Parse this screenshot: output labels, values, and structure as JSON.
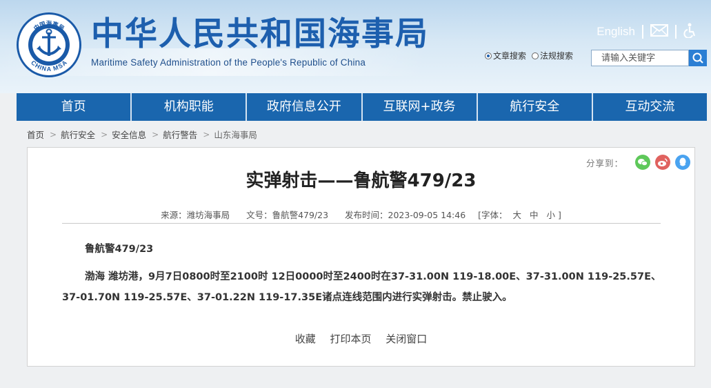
{
  "header": {
    "emblem_text_top": "中国海事局",
    "emblem_text_bottom": "CHINA MSA",
    "site_title": "中华人民共和国海事局",
    "site_subtitle": "Maritime Safety Administration of the People's Republic of China",
    "lang_link": "English",
    "mail_icon": "mail-icon",
    "accessibility_icon": "accessibility-icon"
  },
  "search": {
    "options": [
      {
        "label": "文章搜索",
        "selected": true
      },
      {
        "label": "法规搜索",
        "selected": false
      }
    ],
    "placeholder": "请输入关键字",
    "button_icon": "search-icon"
  },
  "nav": {
    "items": [
      "首页",
      "机构职能",
      "政府信息公开",
      "互联网+政务",
      "航行安全",
      "互动交流"
    ]
  },
  "breadcrumb": [
    "首页",
    "航行安全",
    "安全信息",
    "航行警告",
    "山东海事局"
  ],
  "share": {
    "label": "分享到：",
    "targets": [
      {
        "name": "wechat",
        "icon": "wechat-icon",
        "color": "#5ec85a"
      },
      {
        "name": "weibo",
        "icon": "weibo-icon",
        "color": "#e0625f"
      },
      {
        "name": "qq",
        "icon": "qq-icon",
        "color": "#4aa3f0"
      }
    ]
  },
  "article": {
    "title": "实弹射击——鲁航警479/23",
    "meta": {
      "source": "来源：潍坊海事局",
      "doc_no": "文号：鲁航警479/23",
      "published": "发布时间：2023-09-05 14:46",
      "font_label": "[字体：",
      "font_sizes": [
        "大",
        "中",
        "小"
      ],
      "font_close": "]"
    },
    "paragraph_title": "鲁航警479/23",
    "paragraph_main": "渤海 潍坊港，9月7日0800时至2100时 12日0000时至2400时在37-31.00N 119-18.00E、37-31.00N 119-25.57E、37-01.70N 119-25.57E、37-01.22N 119-17.35E诸点连线范围内进行实弹射击。禁止驶入。"
  },
  "actions": [
    "收藏",
    "打印本页",
    "关闭窗口"
  ],
  "colors": {
    "brand_blue": "#1d5fae",
    "nav_blue": "#1a66ae"
  }
}
